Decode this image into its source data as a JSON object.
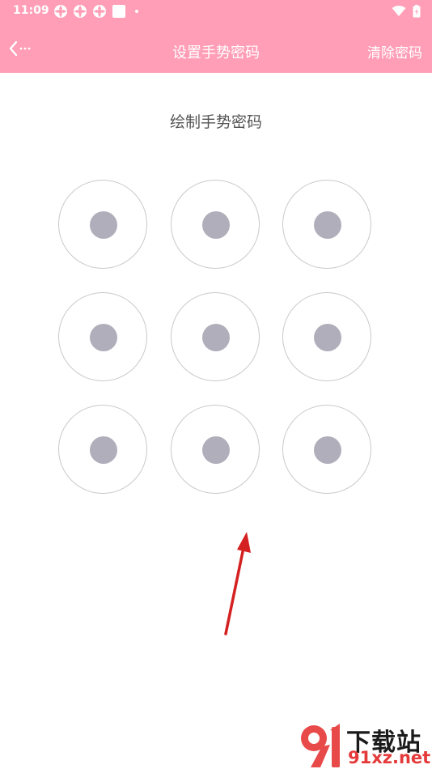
{
  "status_bar": {
    "time": "11:09",
    "notification_icons": [
      "app-notification-icon",
      "app-notification-icon",
      "app-notification-icon",
      "square-notification-icon",
      "dot-icon"
    ],
    "right_icons": [
      "wifi-icon",
      "battery-icon"
    ]
  },
  "app_bar": {
    "background": "#ff9eb6",
    "back_icon": "chevron-left-icon",
    "title": "设置手势密码",
    "clear_label": "清除密码"
  },
  "instruction": "绘制手势密码",
  "pattern": {
    "rows": 3,
    "cols": 3,
    "node_color": "#b0aebb",
    "ring_color": "#c9c9c9"
  },
  "annotation": {
    "arrow_color": "#d42020"
  },
  "watermark": {
    "top_text": "下载站",
    "bottom_text": "91xz.net"
  }
}
